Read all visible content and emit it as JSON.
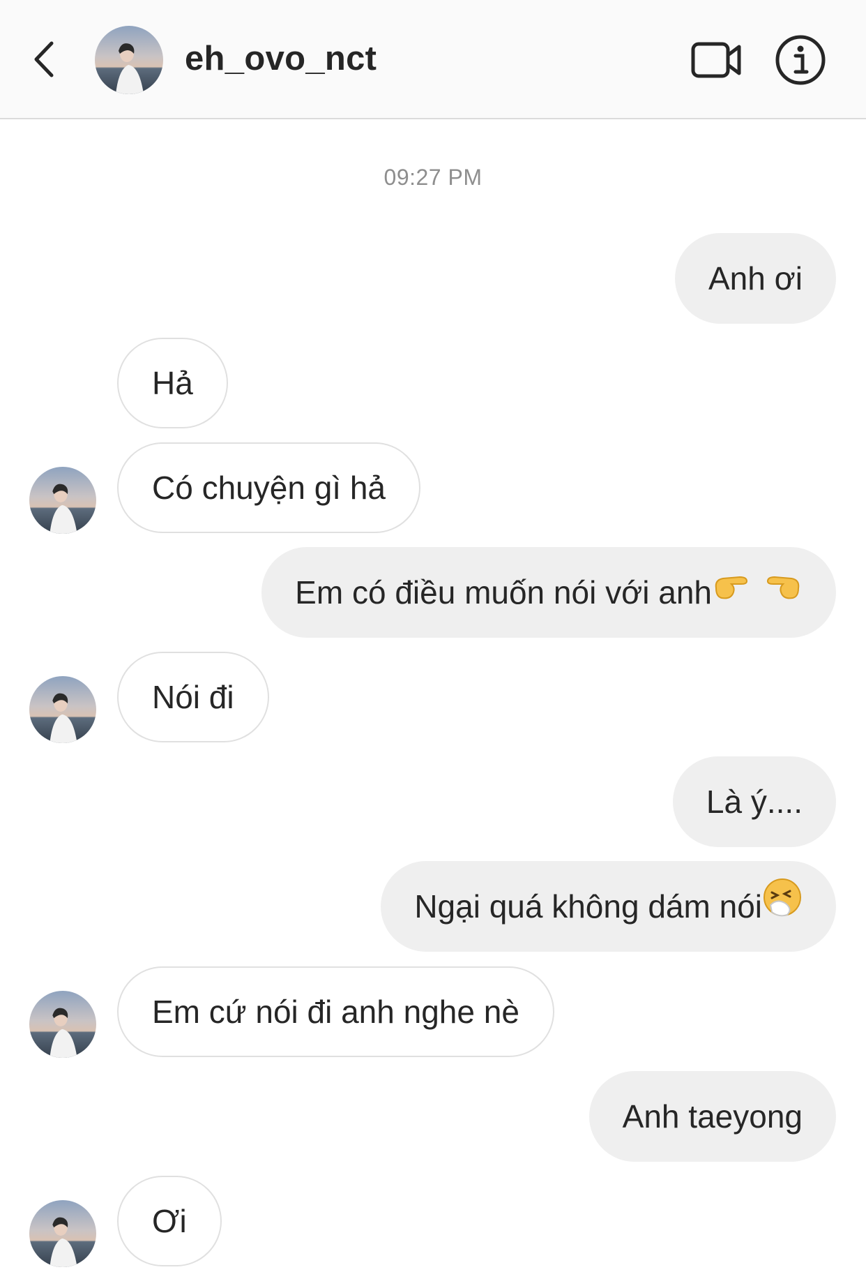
{
  "header": {
    "username": "eh_ovo_nct"
  },
  "timestamp": "09:27 PM",
  "messages": [
    {
      "side": "out",
      "text": "Anh ơi"
    },
    {
      "side": "in",
      "text": "Hả"
    },
    {
      "side": "in",
      "text": "Có chuyện gì hả"
    },
    {
      "side": "out",
      "text": "Em có điều muốn nói với anh",
      "emoji": "pointing-hands-emoji"
    },
    {
      "side": "in",
      "text": "Nói đi"
    },
    {
      "side": "out",
      "text": "Là ý...."
    },
    {
      "side": "out",
      "text": "Ngại quá không dám nói",
      "emoji": "sneezing-face-emoji"
    },
    {
      "side": "in",
      "text": "Em cứ nói đi anh nghe nè"
    },
    {
      "side": "out",
      "text": "Anh taeyong"
    },
    {
      "side": "in",
      "text": "Ơi"
    }
  ],
  "icons": {
    "back": "chevron-left-icon",
    "video": "video-camera-icon",
    "info": "info-circle-icon"
  },
  "colors": {
    "header_bg": "#fafafa",
    "outgoing_bubble": "#efefef",
    "incoming_border": "#e0e0e0",
    "timestamp": "#8e8e8e",
    "text": "#262626"
  }
}
